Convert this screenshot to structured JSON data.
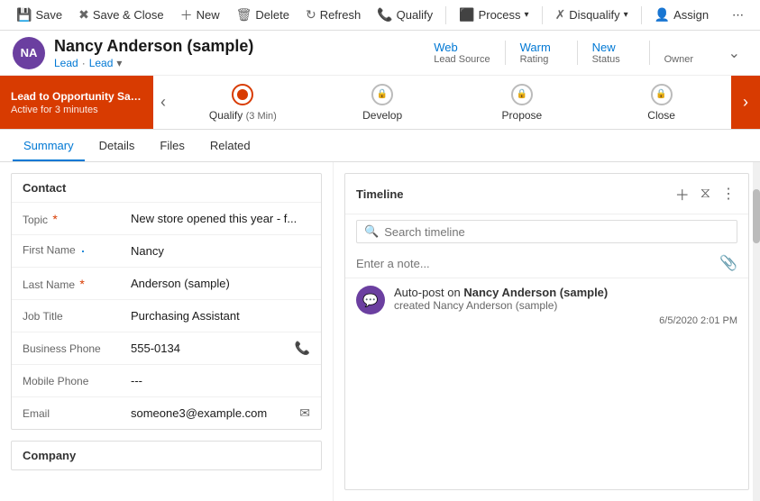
{
  "toolbar": {
    "save_label": "Save",
    "save_close_label": "Save & Close",
    "new_label": "New",
    "delete_label": "Delete",
    "refresh_label": "Refresh",
    "qualify_label": "Qualify",
    "process_label": "Process",
    "disqualify_label": "Disqualify",
    "assign_label": "Assign",
    "more_icon": "⋯"
  },
  "header": {
    "avatar_initials": "NA",
    "name": "Nancy Anderson (sample)",
    "type_label": "Lead",
    "type_link": "Lead",
    "meta": [
      {
        "value": "Web",
        "label": "Lead Source"
      },
      {
        "value": "Warm",
        "label": "Rating"
      },
      {
        "value": "New",
        "label": "Status"
      },
      {
        "value": "",
        "label": "Owner"
      }
    ]
  },
  "stage_bar": {
    "promo_title": "Lead to Opportunity Sale...",
    "promo_sub": "Active for 3 minutes",
    "stages": [
      {
        "name": "Qualify",
        "sub": "(3 Min)",
        "state": "active",
        "locked": false
      },
      {
        "name": "Develop",
        "sub": "",
        "state": "inactive",
        "locked": true
      },
      {
        "name": "Propose",
        "sub": "",
        "state": "inactive",
        "locked": true
      },
      {
        "name": "Close",
        "sub": "",
        "state": "inactive",
        "locked": true
      }
    ]
  },
  "tabs": [
    {
      "label": "Summary",
      "active": true
    },
    {
      "label": "Details",
      "active": false
    },
    {
      "label": "Files",
      "active": false
    },
    {
      "label": "Related",
      "active": false
    }
  ],
  "contact_section": {
    "title": "Contact",
    "fields": [
      {
        "label": "Topic",
        "value": "New store opened this year - f...",
        "required": true,
        "icon": ""
      },
      {
        "label": "First Name",
        "value": "Nancy",
        "required": false,
        "dot": true,
        "icon": ""
      },
      {
        "label": "Last Name",
        "value": "Anderson (sample)",
        "required": true,
        "icon": ""
      },
      {
        "label": "Job Title",
        "value": "Purchasing Assistant",
        "required": false,
        "icon": ""
      },
      {
        "label": "Business Phone",
        "value": "555-0134",
        "required": false,
        "icon": "phone"
      },
      {
        "label": "Mobile Phone",
        "value": "---",
        "required": false,
        "icon": ""
      },
      {
        "label": "Email",
        "value": "someone3@example.com",
        "required": false,
        "icon": "email"
      }
    ]
  },
  "company_section": {
    "title": "Company"
  },
  "timeline": {
    "title": "Timeline",
    "search_placeholder": "Search timeline",
    "note_placeholder": "Enter a note...",
    "entries": [
      {
        "avatar_icon": "💬",
        "title_pre": "Auto-post on",
        "title_bold": "Nancy Anderson (sample)",
        "sub": "created Nancy Anderson (sample)",
        "date": "6/5/2020 2:01 PM"
      }
    ]
  }
}
